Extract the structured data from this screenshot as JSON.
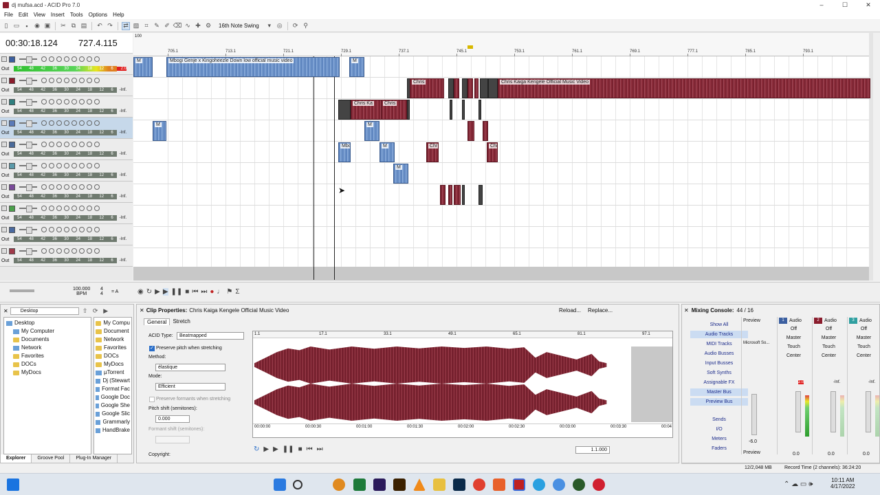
{
  "window": {
    "title": "dj mufsa.acd - ACID Pro 7.0",
    "controls": [
      "–",
      "☐",
      "✕"
    ]
  },
  "menu": [
    "File",
    "Edit",
    "View",
    "Insert",
    "Tools",
    "Options",
    "Help"
  ],
  "toolbar": {
    "swing": "16th Note Swing",
    "zoom_value": "100"
  },
  "time": {
    "position": "00:30:18.124",
    "measure": "727.4.115"
  },
  "ruler": {
    "ticks": [
      "705.1",
      "713.1",
      "721.1",
      "729.1",
      "737.1",
      "745.1",
      "753.1",
      "761.1",
      "769.1",
      "777.1",
      "785.1",
      "793.1"
    ]
  },
  "tracks": {
    "out_label": "Out",
    "meter_labels": [
      "54",
      "48",
      "42",
      "36",
      "30",
      "24",
      "18",
      "12",
      "6"
    ],
    "levels": [
      "2.0",
      "-Inf.",
      "-Inf.",
      "-Inf.",
      "-Inf.",
      "-Inf.",
      "-Inf.",
      "-Inf.",
      "-Inf.",
      "-Inf."
    ],
    "colors": [
      "#3b5fa0",
      "#8a1c2c",
      "#2f7f7f",
      "#5a7ab8",
      "#4a6a9a",
      "#5b9aaa",
      "#7a4a9a",
      "#4aa04a",
      "#4a6aa0",
      "#a03a4a"
    ]
  },
  "clips": {
    "mbogi": "Mbogi Genje x Kingoheezle  Down low official music video",
    "chris_full": "Chris Kaiga  Kengele Official Music Video",
    "chris_short": "Chris Ka",
    "chris": "Chris",
    "chr": "Chr",
    "m": "M",
    "mbo": "Mbo"
  },
  "tempo": {
    "bpm": "100.000",
    "bpm_label": "BPM",
    "sig_top": "4",
    "sig_bottom": "4",
    "key": "= A"
  },
  "explorer": {
    "location": "Desktop",
    "tree": [
      "Desktop",
      "My Computer",
      "Documents",
      "Network",
      "Favorites",
      "DOCs",
      "MyDocs"
    ],
    "list": [
      "My Compu",
      "Document",
      "Network",
      "Favorites",
      "DOCs",
      "MyDocs",
      "µTorrent",
      "Dj (Stewart",
      "Format Fac",
      "Google Doc",
      "Google She",
      "Google Slic",
      "Grammarly",
      "HandBrake"
    ],
    "tabs": [
      "Explorer",
      "Groove Pool",
      "Plug-In Manager"
    ]
  },
  "clip_properties": {
    "title": "Clip Properties:",
    "clip_name": "Chris Kaiga  Kengele Official Music Video",
    "reload": "Reload...",
    "replace": "Replace...",
    "tabs": [
      "General",
      "Stretch"
    ],
    "acid_type_label": "ACID Type:",
    "acid_type_value": "Beatmapped",
    "preserve_pitch": "Preserve pitch when stretching",
    "method_label": "Method:",
    "method_value": "élastique",
    "mode_label": "Mode:",
    "mode_value": "Efficient",
    "preserve_formants": "Preserve formants when stretching",
    "pitch_shift_label": "Pitch shift (semitones):",
    "pitch_shift_value": "0.000",
    "formant_shift_label": "Formant shift (semitones):",
    "copyright_label": "Copyright:",
    "wave_ruler": [
      "1.1",
      "17.1",
      "33.1",
      "49.1",
      "65.1",
      "81.1",
      "97.1"
    ],
    "wave_time": [
      "00:00:00",
      "00:00:30",
      "00:01:00",
      "00:01:30",
      "00:02:00",
      "00:02:30",
      "00:03:00",
      "00:03:30",
      "00:04"
    ],
    "wave_position": "1.1.000"
  },
  "mixer": {
    "title": "Mixing Console:",
    "count": "44 / 16",
    "buttons": [
      "Show All",
      "Audio Tracks",
      "MIDI Tracks",
      "Audio Busses",
      "Input Busses",
      "Soft Synths",
      "Assignable FX",
      "Master Bus",
      "Preview Bus",
      "Sends",
      "I/O",
      "Meters",
      "Faders"
    ],
    "preview": {
      "name": "Preview",
      "device": "Microsoft So...",
      "level": "-6.0",
      "footer": "Preview"
    },
    "channels": [
      {
        "num": "1",
        "name": "Audio",
        "off": "Off",
        "out": "Master",
        "auto": "Touch",
        "pan": "Center",
        "level": "0.0",
        "peak": "2.0",
        "color": "#3b5fa0"
      },
      {
        "num": "2",
        "name": "Audio",
        "off": "Off",
        "out": "Master",
        "auto": "Touch",
        "pan": "Center",
        "level": "0.0",
        "peak": "-Inf.",
        "color": "#8a1c2c"
      },
      {
        "num": "3",
        "name": "Audio",
        "off": "Off",
        "out": "Master",
        "auto": "Touch",
        "pan": "Center",
        "level": "0.0",
        "peak": "-Inf.",
        "color": "#2f9fa0"
      }
    ]
  },
  "status": {
    "memory": "12/2,048 MB",
    "record_time": "Record Time (2 channels): 36:24:20"
  },
  "taskbar": {
    "time": "10:11 AM",
    "date": "4/17/2022"
  }
}
